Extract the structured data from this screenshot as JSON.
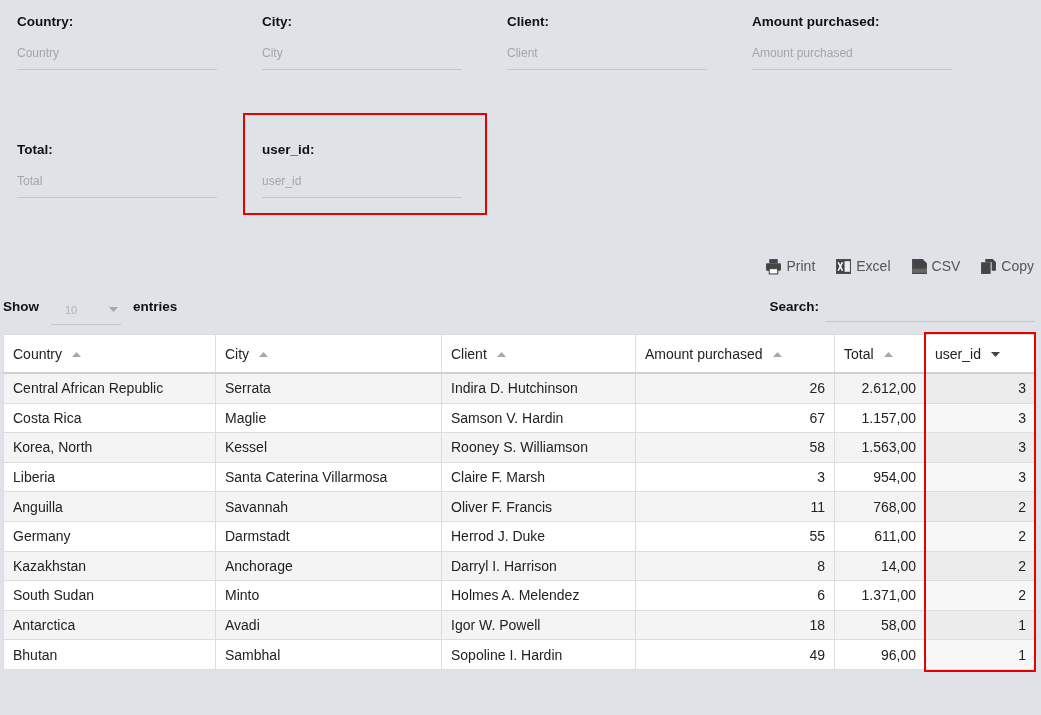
{
  "filters": [
    {
      "label": "Country:",
      "placeholder": "Country",
      "highlighted": false
    },
    {
      "label": "City:",
      "placeholder": "City",
      "highlighted": false
    },
    {
      "label": "Client:",
      "placeholder": "Client",
      "highlighted": false
    },
    {
      "label": "Amount purchased:",
      "placeholder": "Amount purchased",
      "highlighted": false
    },
    {
      "label": "Total:",
      "placeholder": "Total",
      "highlighted": false
    },
    {
      "label": "user_id:",
      "placeholder": "user_id",
      "highlighted": true
    }
  ],
  "export_buttons": [
    {
      "label": "Print",
      "kind": "print"
    },
    {
      "label": "Excel",
      "kind": "excel"
    },
    {
      "label": "CSV",
      "kind": "csv"
    },
    {
      "label": "Copy",
      "kind": "copy"
    }
  ],
  "length": {
    "before": "Show",
    "value": "10",
    "after": "entries"
  },
  "search": {
    "label": "Search:"
  },
  "table": {
    "columns": [
      {
        "label": "Country",
        "sorted": false,
        "kind": "text",
        "highlighted": false
      },
      {
        "label": "City",
        "sorted": false,
        "kind": "text",
        "highlighted": false
      },
      {
        "label": "Client",
        "sorted": false,
        "kind": "text",
        "highlighted": false
      },
      {
        "label": "Amount purchased",
        "sorted": false,
        "kind": "number",
        "highlighted": false
      },
      {
        "label": "Total",
        "sorted": false,
        "kind": "number",
        "highlighted": false
      },
      {
        "label": "user_id",
        "sorted": true,
        "kind": "number",
        "highlighted": true
      }
    ],
    "rows": [
      [
        "Central African Republic",
        "Serrata",
        "Indira D. Hutchinson",
        "26",
        "2.612,00",
        "3"
      ],
      [
        "Costa Rica",
        "Maglie",
        "Samson V. Hardin",
        "67",
        "1.157,00",
        "3"
      ],
      [
        "Korea, North",
        "Kessel",
        "Rooney S. Williamson",
        "58",
        "1.563,00",
        "3"
      ],
      [
        "Liberia",
        "Santa Caterina Villarmosa",
        "Claire F. Marsh",
        "3",
        "954,00",
        "3"
      ],
      [
        "Anguilla",
        "Savannah",
        "Oliver F. Francis",
        "11",
        "768,00",
        "2"
      ],
      [
        "Germany",
        "Darmstadt",
        "Herrod J. Duke",
        "55",
        "611,00",
        "2"
      ],
      [
        "Kazakhstan",
        "Anchorage",
        "Darryl I. Harrison",
        "8",
        "14,00",
        "2"
      ],
      [
        "South Sudan",
        "Minto",
        "Holmes A. Melendez",
        "6",
        "1.371,00",
        "2"
      ],
      [
        "Antarctica",
        "Avadi",
        "Igor W. Powell",
        "18",
        "58,00",
        "1"
      ],
      [
        "Bhutan",
        "Sambhal",
        "Sopoline I. Hardin",
        "49",
        "96,00",
        "1"
      ]
    ]
  }
}
